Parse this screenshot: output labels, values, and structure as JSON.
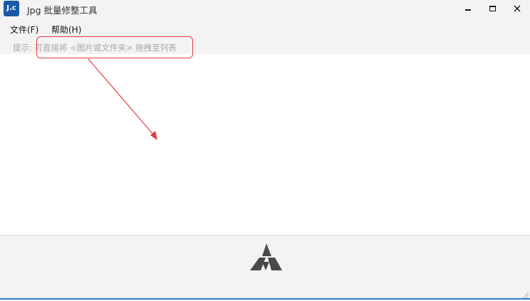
{
  "window": {
    "title": "Jpg 批量修整工具",
    "icon_label": "J.c"
  },
  "menu": {
    "items": [
      {
        "label": "文件(F)"
      },
      {
        "label": "帮助(H)"
      }
    ]
  },
  "hint": {
    "text": "提示: 可直接将 <图片或文件夹> 拖拽至列表"
  },
  "annotation": {
    "color": "#e23b3b"
  },
  "colors": {
    "accent": "#2d7fcf",
    "background": "#f3f3f3",
    "list_background": "#ffffff",
    "logo": "#4a4a4a"
  },
  "icons": {
    "app": "jpg-app-icon",
    "minimize": "minimize-icon",
    "maximize": "maximize-icon",
    "close": "close-icon",
    "logo": "triangle-logo-icon",
    "grip": "resize-grip-icon"
  }
}
